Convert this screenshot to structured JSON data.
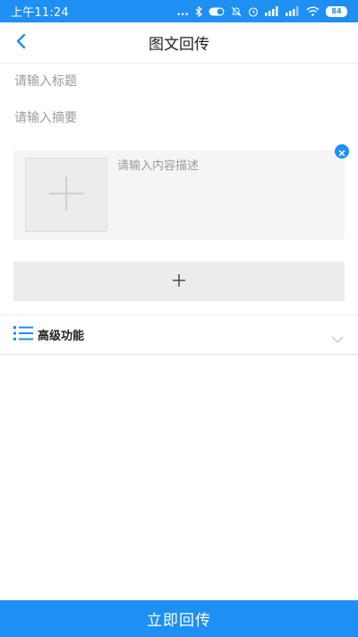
{
  "status_bar": {
    "time": "上午11:24",
    "dots": "...",
    "battery": "84"
  },
  "header": {
    "title": "图文回传",
    "back_icon": "chevron-left-icon"
  },
  "form": {
    "title_placeholder": "请输入标题",
    "summary_placeholder": "请输入摘要",
    "content_placeholder": "请输入内容描述",
    "add_block_icon": "plus-icon"
  },
  "advanced": {
    "label": "高级功能",
    "icon": "list-icon",
    "toggle_icon": "chevron-down-icon"
  },
  "footer": {
    "submit_label": "立即回传"
  },
  "colors": {
    "accent": "#1e8ff3"
  }
}
